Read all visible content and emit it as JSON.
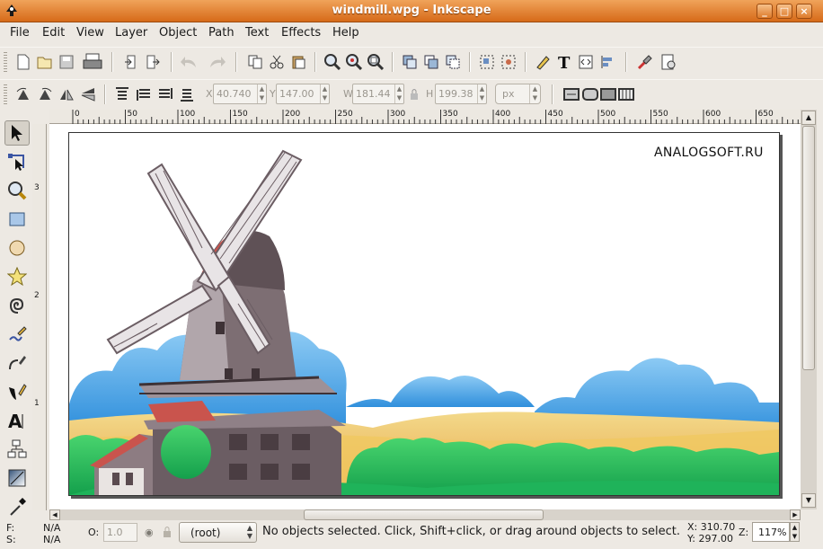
{
  "window": {
    "title": "windmill.wpg - Inkscape",
    "controls": [
      "_",
      "□",
      "×"
    ]
  },
  "menu": [
    "File",
    "Edit",
    "View",
    "Layer",
    "Object",
    "Path",
    "Text",
    "Effects",
    "Help"
  ],
  "controls_bar": {
    "x_label": "X",
    "x_value": "40.740",
    "y_label": "Y",
    "y_value": "147.00",
    "w_label": "W",
    "w_value": "181.44",
    "h_label": "H",
    "h_value": "199.38",
    "unit": "px"
  },
  "ruler": {
    "h_labels": [
      "0",
      "50",
      "100",
      "150",
      "200",
      "250",
      "300",
      "350",
      "400",
      "450",
      "500",
      "550",
      "600",
      "650"
    ],
    "v_labels": [
      "3",
      "2",
      "1"
    ]
  },
  "canvas": {
    "watermark": "ANALOGSOFT.RU"
  },
  "status": {
    "fill_label": "F:",
    "fill_value": "N/A",
    "stroke_label": "S:",
    "stroke_value": "N/A",
    "opacity_label": "O:",
    "opacity_value": "1.0",
    "layer": "(root)",
    "message": "No objects selected. Click, Shift+click, or drag around objects to select.",
    "cursor_x": "X: 310.70",
    "cursor_y": "Y: 297.00",
    "zoom_label": "Z:",
    "zoom_value": "117%"
  },
  "colors": {
    "titlebar": "#d66a19",
    "sky": "#5aaee8",
    "field": "#f0c860",
    "bushes": "#2fbe5a",
    "mill": "#7d6e73",
    "roof": "#c9544d"
  }
}
